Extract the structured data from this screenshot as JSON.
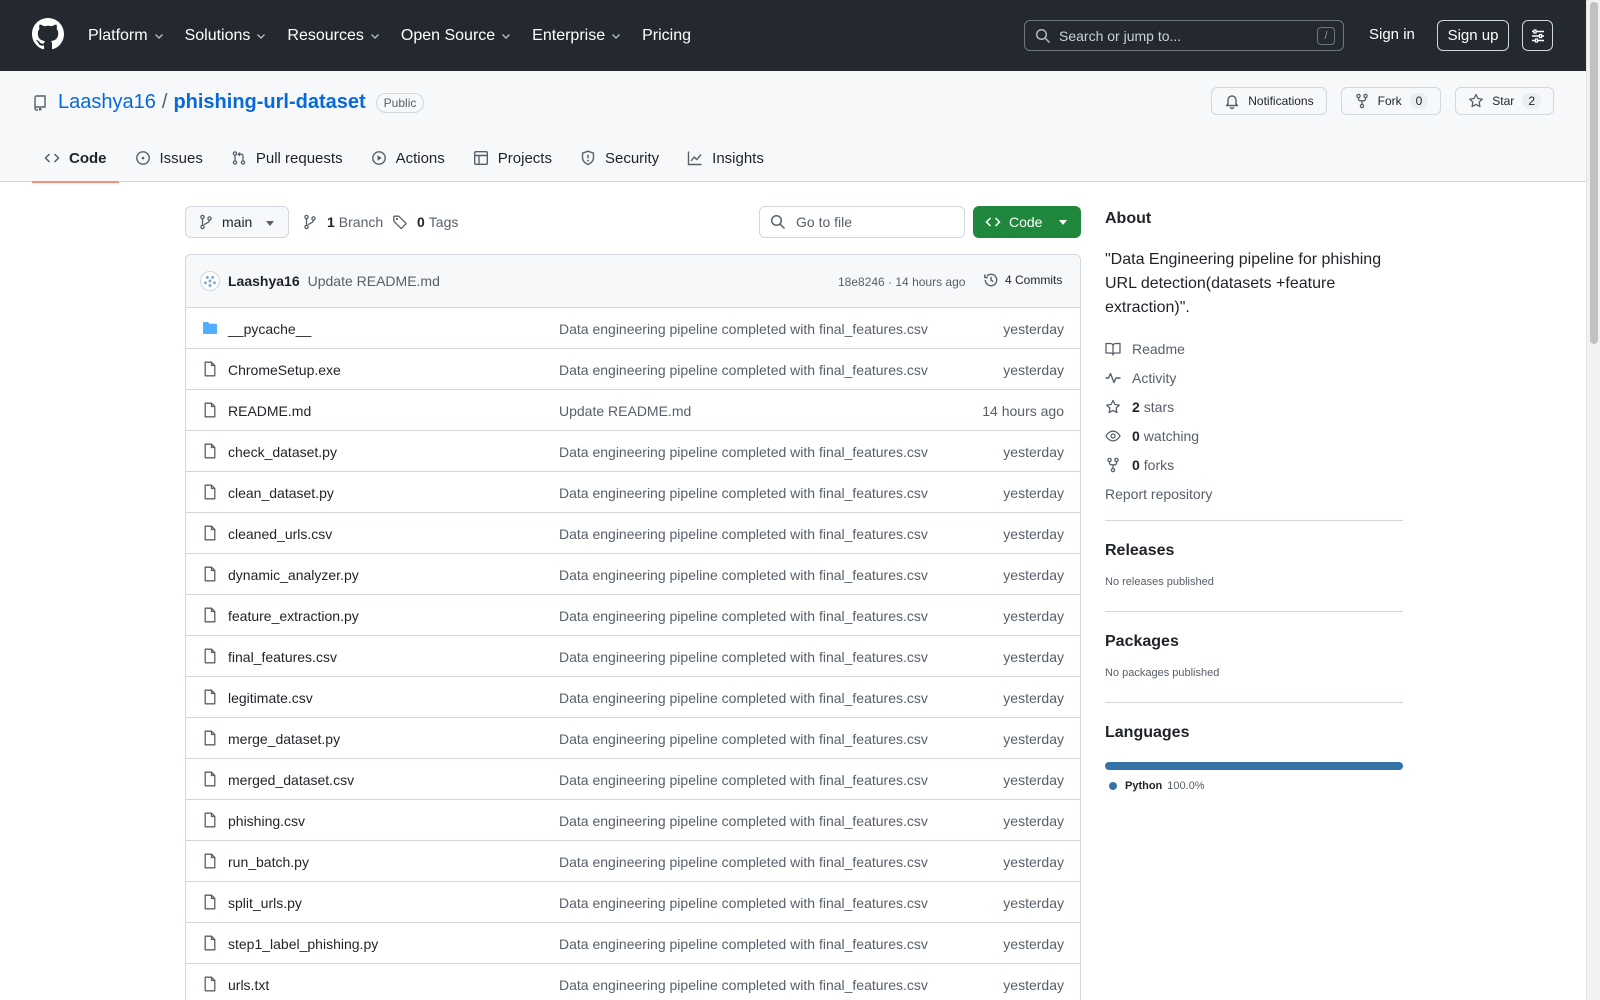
{
  "nav": {
    "items": [
      "Platform",
      "Solutions",
      "Resources",
      "Open Source",
      "Enterprise",
      "Pricing"
    ],
    "search_placeholder": "Search or jump to...",
    "search_key": "/",
    "signin": "Sign in",
    "signup": "Sign up"
  },
  "repo": {
    "owner": "Laashya16",
    "separator": "/",
    "name": "phishing-url-dataset",
    "visibility": "Public",
    "notifications": "Notifications",
    "fork_label": "Fork",
    "fork_count": "0",
    "star_label": "Star",
    "star_count": "2"
  },
  "tabs": [
    "Code",
    "Issues",
    "Pull requests",
    "Actions",
    "Projects",
    "Security",
    "Insights"
  ],
  "toolbar": {
    "branch": "main",
    "branch_count": "1",
    "branch_label": "Branch",
    "tag_count": "0",
    "tag_label": "Tags",
    "goto_placeholder": "Go to file",
    "code_label": "Code"
  },
  "commit": {
    "author": "Laashya16",
    "message": "Update README.md",
    "hash_time": "18e8246 · 14 hours ago",
    "commits": "4 Commits"
  },
  "files": [
    {
      "name": "__pycache__",
      "type": "folder",
      "message": "Data engineering pipeline completed with final_features.csv",
      "date": "yesterday"
    },
    {
      "name": "ChromeSetup.exe",
      "type": "file",
      "message": "Data engineering pipeline completed with final_features.csv",
      "date": "yesterday"
    },
    {
      "name": "README.md",
      "type": "file",
      "message": "Update README.md",
      "date": "14 hours ago"
    },
    {
      "name": "check_dataset.py",
      "type": "file",
      "message": "Data engineering pipeline completed with final_features.csv",
      "date": "yesterday"
    },
    {
      "name": "clean_dataset.py",
      "type": "file",
      "message": "Data engineering pipeline completed with final_features.csv",
      "date": "yesterday"
    },
    {
      "name": "cleaned_urls.csv",
      "type": "file",
      "message": "Data engineering pipeline completed with final_features.csv",
      "date": "yesterday"
    },
    {
      "name": "dynamic_analyzer.py",
      "type": "file",
      "message": "Data engineering pipeline completed with final_features.csv",
      "date": "yesterday"
    },
    {
      "name": "feature_extraction.py",
      "type": "file",
      "message": "Data engineering pipeline completed with final_features.csv",
      "date": "yesterday"
    },
    {
      "name": "final_features.csv",
      "type": "file",
      "message": "Data engineering pipeline completed with final_features.csv",
      "date": "yesterday"
    },
    {
      "name": "legitimate.csv",
      "type": "file",
      "message": "Data engineering pipeline completed with final_features.csv",
      "date": "yesterday"
    },
    {
      "name": "merge_dataset.py",
      "type": "file",
      "message": "Data engineering pipeline completed with final_features.csv",
      "date": "yesterday"
    },
    {
      "name": "merged_dataset.csv",
      "type": "file",
      "message": "Data engineering pipeline completed with final_features.csv",
      "date": "yesterday"
    },
    {
      "name": "phishing.csv",
      "type": "file",
      "message": "Data engineering pipeline completed with final_features.csv",
      "date": "yesterday"
    },
    {
      "name": "run_batch.py",
      "type": "file",
      "message": "Data engineering pipeline completed with final_features.csv",
      "date": "yesterday"
    },
    {
      "name": "split_urls.py",
      "type": "file",
      "message": "Data engineering pipeline completed with final_features.csv",
      "date": "yesterday"
    },
    {
      "name": "step1_label_phishing.py",
      "type": "file",
      "message": "Data engineering pipeline completed with final_features.csv",
      "date": "yesterday"
    },
    {
      "name": "urls.txt",
      "type": "file",
      "message": "Data engineering pipeline completed with final_features.csv",
      "date": "yesterday"
    }
  ],
  "about": {
    "title": "About",
    "description": "\"Data Engineering pipeline for phishing URL detection(datasets +feature extraction)\".",
    "readme": "Readme",
    "activity": "Activity",
    "stars_count": "2",
    "stars_label": "stars",
    "watching_count": "0",
    "watching_label": "watching",
    "forks_count": "0",
    "forks_label": "forks",
    "report": "Report repository"
  },
  "releases": {
    "title": "Releases",
    "text": "No releases published"
  },
  "packages": {
    "title": "Packages",
    "text": "No packages published"
  },
  "languages": {
    "title": "Languages",
    "items": [
      {
        "name": "Python",
        "percent": "100.0%",
        "share": 1.0,
        "color": "#3572A5"
      }
    ]
  }
}
